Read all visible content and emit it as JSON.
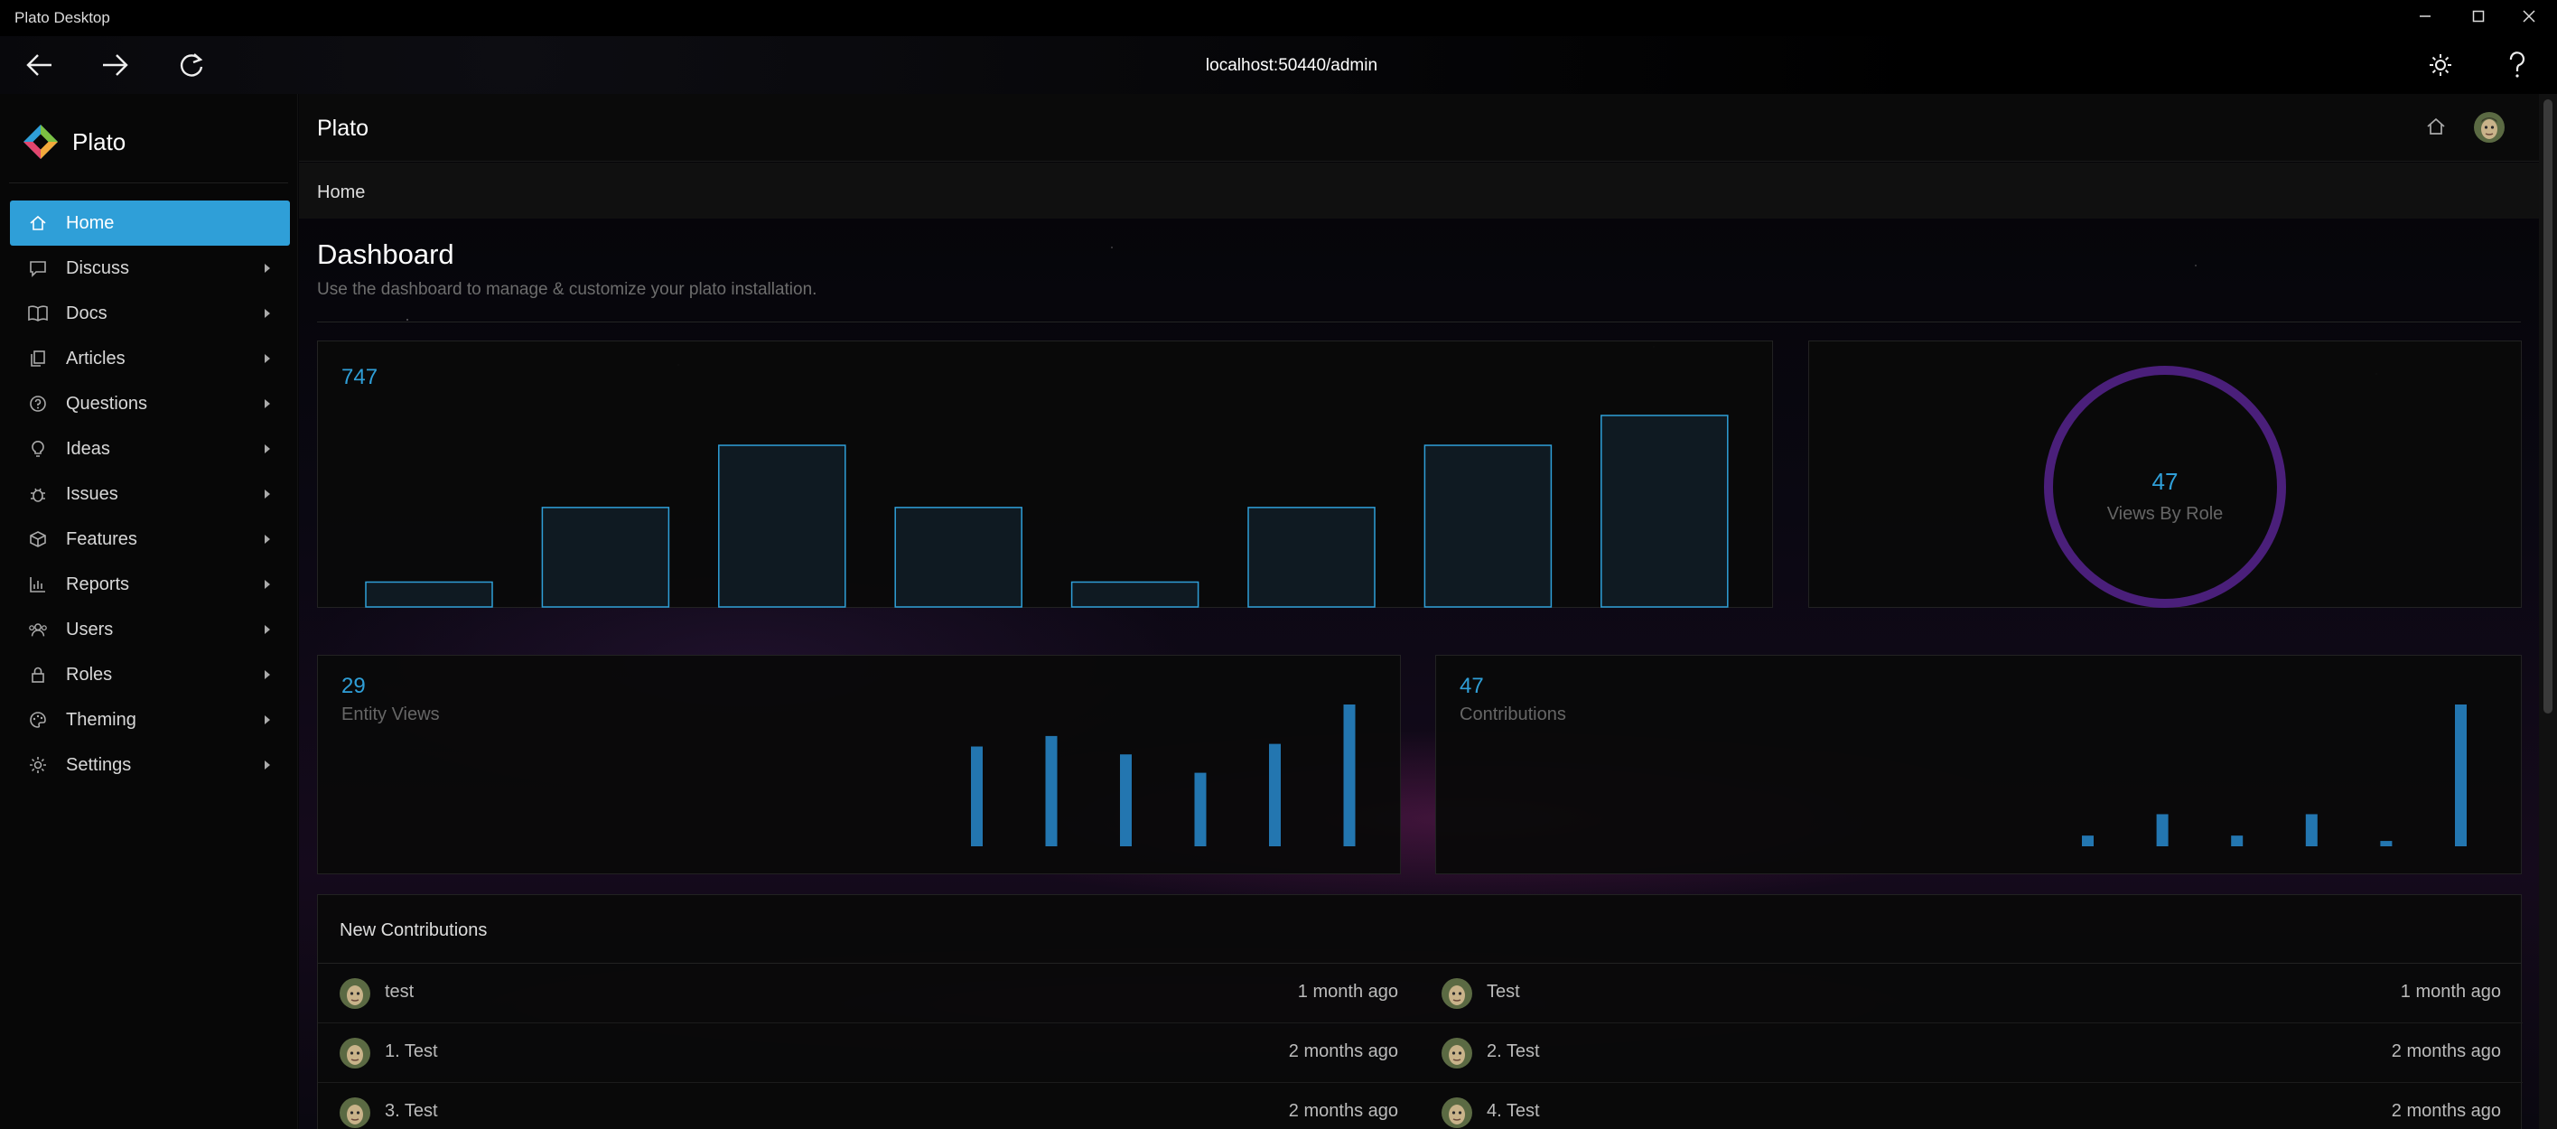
{
  "window": {
    "title": "Plato Desktop",
    "address": "localhost:50440/admin"
  },
  "icons": {
    "back": "arrow-left-icon",
    "forward": "arrow-right-icon",
    "reload": "refresh-icon",
    "settings": "gear-icon",
    "help": "help-icon",
    "home": "home-icon"
  },
  "colors": {
    "accent": "#2f9fd8",
    "donut": "#4a1f7a",
    "active_menu": "#2f9fd8"
  },
  "sidebar": {
    "brand": "Plato",
    "items": [
      {
        "label": "Home",
        "icon": "home-icon",
        "active": true
      },
      {
        "label": "Discuss",
        "icon": "chat-icon"
      },
      {
        "label": "Docs",
        "icon": "book-icon"
      },
      {
        "label": "Articles",
        "icon": "copy-icon"
      },
      {
        "label": "Questions",
        "icon": "question-circle-icon"
      },
      {
        "label": "Ideas",
        "icon": "lightbulb-icon"
      },
      {
        "label": "Issues",
        "icon": "bug-icon"
      },
      {
        "label": "Features",
        "icon": "box-icon"
      },
      {
        "label": "Reports",
        "icon": "bar-chart-icon"
      },
      {
        "label": "Users",
        "icon": "users-icon"
      },
      {
        "label": "Roles",
        "icon": "lock-icon"
      },
      {
        "label": "Theming",
        "icon": "palette-icon"
      },
      {
        "label": "Settings",
        "icon": "gear-icon"
      }
    ]
  },
  "header": {
    "site_name": "Plato"
  },
  "breadcrumb": "Home",
  "dashboard": {
    "title": "Dashboard",
    "subtitle": "Use the dashboard to manage & customize your plato installation."
  },
  "chart_data": [
    {
      "type": "bar",
      "title": "747",
      "values": [
        1,
        4,
        6.5,
        4,
        1,
        4,
        6.5,
        7.7
      ]
    },
    {
      "type": "pie",
      "title": "47",
      "subtitle": "Views By Role",
      "values": [
        47
      ]
    },
    {
      "type": "bar",
      "title": "29",
      "subtitle": "Entity Views",
      "values": [
        3.8,
        4.2,
        3.5,
        2.8,
        3.9,
        5.4
      ]
    },
    {
      "type": "bar",
      "title": "47",
      "subtitle": "Contributions",
      "values": [
        0.4,
        1.2,
        0.4,
        1.2,
        0.2,
        5.3
      ]
    }
  ],
  "contributions": {
    "header": "New Contributions",
    "left": [
      {
        "title": "test",
        "time": "1 month ago"
      },
      {
        "title": "1. Test",
        "time": "2 months ago"
      },
      {
        "title": "3. Test",
        "time": "2 months ago"
      }
    ],
    "right": [
      {
        "title": "Test",
        "time": "1 month ago"
      },
      {
        "title": "2. Test",
        "time": "2 months ago"
      },
      {
        "title": "4. Test",
        "time": "2 months ago"
      }
    ]
  }
}
